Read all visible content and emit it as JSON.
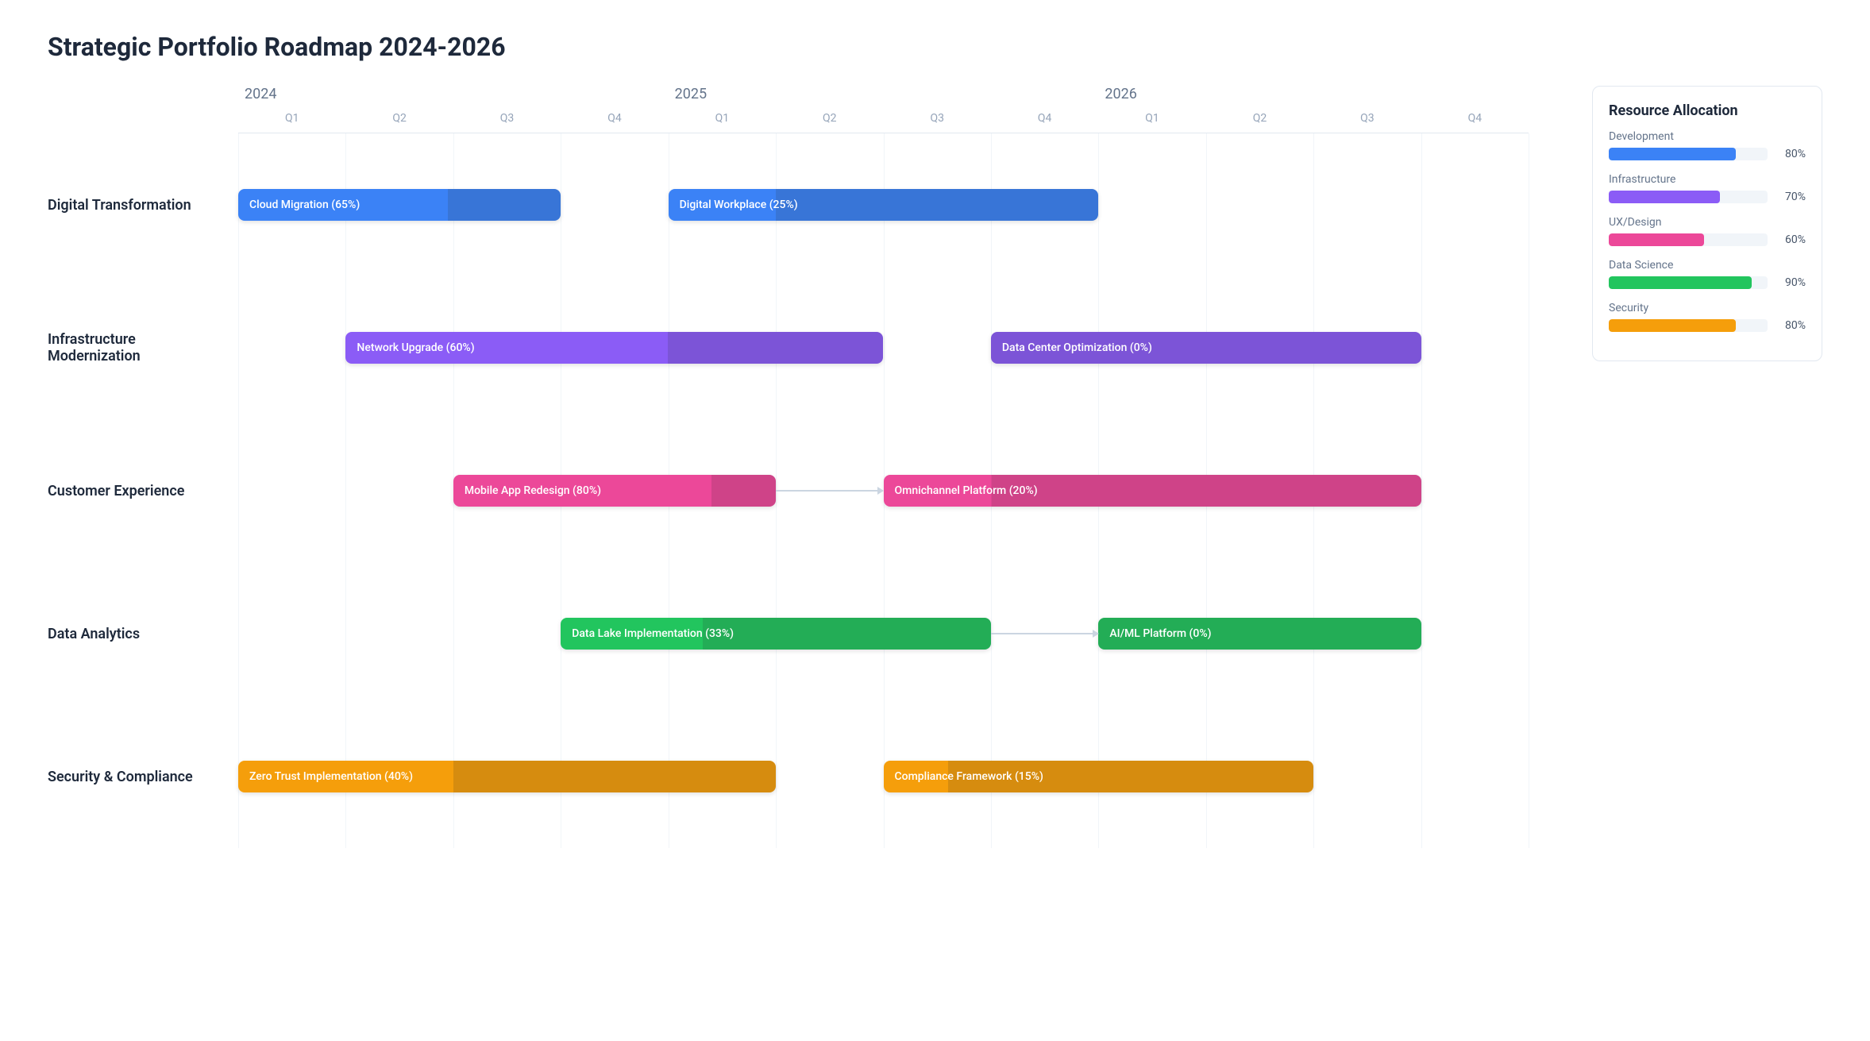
{
  "title": "Strategic Portfolio Roadmap 2024-2026",
  "years": [
    "2024",
    "2025",
    "2026"
  ],
  "quarters_per_year": [
    "Q1",
    "Q2",
    "Q3",
    "Q4"
  ],
  "colors": {
    "development": "#3b82f6",
    "infrastructure": "#8b5cf6",
    "ux": "#ec4899",
    "data": "#22c55e",
    "security": "#f59e0b"
  },
  "swimlanes": [
    {
      "label": "Digital Transformation",
      "colorKey": "development",
      "tasks": [
        {
          "name": "Cloud Migration",
          "start": 0,
          "span": 3,
          "progress": 65
        },
        {
          "name": "Digital Workplace",
          "start": 4,
          "span": 4,
          "progress": 25
        }
      ]
    },
    {
      "label": "Infrastructure Modernization",
      "colorKey": "infrastructure",
      "tasks": [
        {
          "name": "Network Upgrade",
          "start": 1,
          "span": 5,
          "progress": 60
        },
        {
          "name": "Data Center Optimization",
          "start": 7,
          "span": 4,
          "progress": 0
        }
      ]
    },
    {
      "label": "Customer Experience",
      "colorKey": "ux",
      "tasks": [
        {
          "name": "Mobile App Redesign",
          "start": 2,
          "span": 3,
          "progress": 80
        },
        {
          "name": "Omnichannel Platform",
          "start": 6,
          "span": 5,
          "progress": 20
        }
      ],
      "dependency": {
        "fromTask": 0,
        "toTask": 1
      }
    },
    {
      "label": "Data Analytics",
      "colorKey": "data",
      "tasks": [
        {
          "name": "Data Lake Implementation",
          "start": 3,
          "span": 4,
          "progress": 33
        },
        {
          "name": "AI/ML Platform",
          "start": 8,
          "span": 3,
          "progress": 0
        }
      ],
      "dependency": {
        "fromTask": 0,
        "toTask": 1
      }
    },
    {
      "label": "Security & Compliance",
      "colorKey": "security",
      "tasks": [
        {
          "name": "Zero Trust Implementation",
          "start": 0,
          "span": 5,
          "progress": 40
        },
        {
          "name": "Compliance Framework",
          "start": 6,
          "span": 4,
          "progress": 15
        }
      ]
    }
  ],
  "legend": {
    "title": "Resource Allocation",
    "items": [
      {
        "label": "Development",
        "pct": 80,
        "colorKey": "development"
      },
      {
        "label": "Infrastructure",
        "pct": 70,
        "colorKey": "infrastructure"
      },
      {
        "label": "UX/Design",
        "pct": 60,
        "colorKey": "ux"
      },
      {
        "label": "Data Science",
        "pct": 90,
        "colorKey": "data"
      },
      {
        "label": "Security",
        "pct": 80,
        "colorKey": "security"
      }
    ]
  },
  "chart_data": {
    "type": "gantt",
    "title": "Strategic Portfolio Roadmap 2024-2026",
    "time_axis": {
      "years": [
        "2024",
        "2025",
        "2026"
      ],
      "quarters": [
        "Q1",
        "Q2",
        "Q3",
        "Q4",
        "Q1",
        "Q2",
        "Q3",
        "Q4",
        "Q1",
        "Q2",
        "Q3",
        "Q4"
      ]
    },
    "rows": [
      {
        "swimlane": "Digital Transformation",
        "tasks": [
          {
            "name": "Cloud Migration",
            "start_q_index": 0,
            "duration_quarters": 3,
            "progress_pct": 65
          },
          {
            "name": "Digital Workplace",
            "start_q_index": 4,
            "duration_quarters": 4,
            "progress_pct": 25
          }
        ]
      },
      {
        "swimlane": "Infrastructure Modernization",
        "tasks": [
          {
            "name": "Network Upgrade",
            "start_q_index": 1,
            "duration_quarters": 5,
            "progress_pct": 60
          },
          {
            "name": "Data Center Optimization",
            "start_q_index": 7,
            "duration_quarters": 4,
            "progress_pct": 0
          }
        ]
      },
      {
        "swimlane": "Customer Experience",
        "tasks": [
          {
            "name": "Mobile App Redesign",
            "start_q_index": 2,
            "duration_quarters": 3,
            "progress_pct": 80
          },
          {
            "name": "Omnichannel Platform",
            "start_q_index": 6,
            "duration_quarters": 5,
            "progress_pct": 20
          }
        ],
        "dependencies": [
          {
            "from": "Mobile App Redesign",
            "to": "Omnichannel Platform"
          }
        ]
      },
      {
        "swimlane": "Data Analytics",
        "tasks": [
          {
            "name": "Data Lake Implementation",
            "start_q_index": 3,
            "duration_quarters": 4,
            "progress_pct": 33
          },
          {
            "name": "AI/ML Platform",
            "start_q_index": 8,
            "duration_quarters": 3,
            "progress_pct": 0
          }
        ],
        "dependencies": [
          {
            "from": "Data Lake Implementation",
            "to": "AI/ML Platform"
          }
        ]
      },
      {
        "swimlane": "Security & Compliance",
        "tasks": [
          {
            "name": "Zero Trust Implementation",
            "start_q_index": 0,
            "duration_quarters": 5,
            "progress_pct": 40
          },
          {
            "name": "Compliance Framework",
            "start_q_index": 6,
            "duration_quarters": 4,
            "progress_pct": 15
          }
        ]
      }
    ],
    "resource_allocation": [
      {
        "team": "Development",
        "pct": 80,
        "color": "#3b82f6"
      },
      {
        "team": "Infrastructure",
        "pct": 70,
        "color": "#8b5cf6"
      },
      {
        "team": "UX/Design",
        "pct": 60,
        "color": "#ec4899"
      },
      {
        "team": "Data Science",
        "pct": 90,
        "color": "#22c55e"
      },
      {
        "team": "Security",
        "pct": 80,
        "color": "#f59e0b"
      }
    ]
  }
}
